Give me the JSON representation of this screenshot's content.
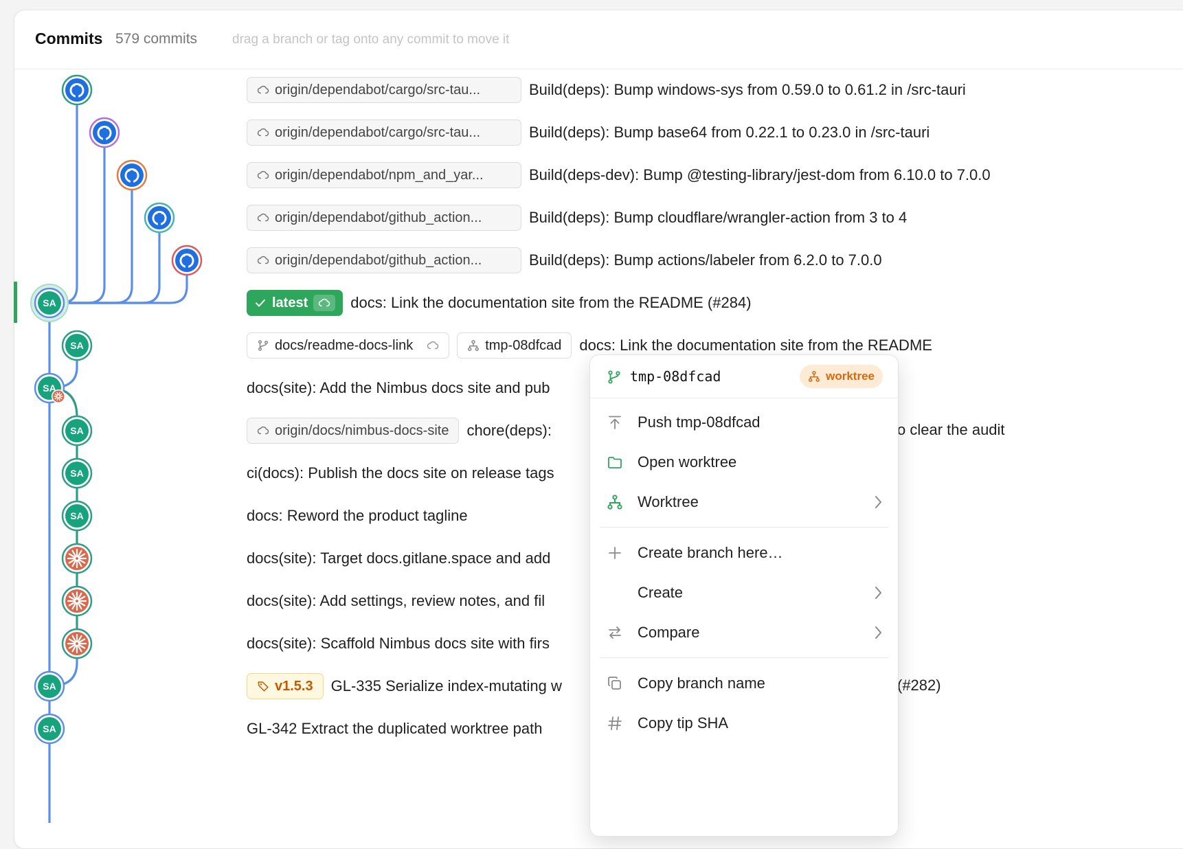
{
  "header": {
    "title": "Commits",
    "count": "579 commits",
    "hint": "drag a branch or tag onto any commit to move it"
  },
  "colors": {
    "graph_blue": "#5b8fe6",
    "graph_green": "#2e9c86",
    "node_green": "#17a37e",
    "github_blue": "#1f6fe0",
    "latest_green": "#2ea65b",
    "worktree_orange": "#d5690f",
    "tag_orange": "#c25a00"
  },
  "graph": {
    "nodes": [
      {
        "icon": "github-avatar-icon",
        "ring": "#2e9c86"
      },
      {
        "icon": "github-avatar-icon",
        "ring": "#b66fd8"
      },
      {
        "icon": "github-avatar-icon",
        "ring": "#e07d3c"
      },
      {
        "icon": "github-avatar-icon",
        "ring": "#43b3b3"
      },
      {
        "icon": "github-avatar-icon",
        "ring": "#dd5a5a"
      },
      {
        "label": "SA",
        "icon": "avatar",
        "selected": true
      },
      {
        "label": "SA",
        "icon": "avatar"
      },
      {
        "label": "SA",
        "icon": "avatar",
        "merge": true
      },
      {
        "label": "SA",
        "icon": "avatar"
      },
      {
        "label": "SA",
        "icon": "avatar"
      },
      {
        "label": "SA",
        "icon": "avatar"
      },
      {
        "icon": "claude-avatar-icon"
      },
      {
        "icon": "claude-avatar-icon"
      },
      {
        "icon": "claude-avatar-icon"
      },
      {
        "label": "SA",
        "icon": "avatar"
      },
      {
        "label": "SA",
        "icon": "avatar"
      }
    ]
  },
  "commits": [
    {
      "refs": [
        {
          "type": "remote",
          "label": "origin/dependabot/cargo/src-tau..."
        }
      ],
      "message": "Build(deps): Bump windows-sys from 0.59.0 to 0.61.2 in /src-tauri"
    },
    {
      "refs": [
        {
          "type": "remote",
          "label": "origin/dependabot/cargo/src-tau..."
        }
      ],
      "message": "Build(deps): Bump base64 from 0.22.1 to 0.23.0 in /src-tauri"
    },
    {
      "refs": [
        {
          "type": "remote",
          "label": "origin/dependabot/npm_and_yar..."
        }
      ],
      "message": "Build(deps-dev): Bump @testing-library/jest-dom from 6.10.0 to 7.0.0"
    },
    {
      "refs": [
        {
          "type": "remote",
          "label": "origin/dependabot/github_action..."
        }
      ],
      "message": "Build(deps): Bump cloudflare/wrangler-action from 3 to 4"
    },
    {
      "refs": [
        {
          "type": "remote",
          "label": "origin/dependabot/github_action..."
        }
      ],
      "message": "Build(deps): Bump actions/labeler from 6.2.0 to 7.0.0"
    },
    {
      "refs": [
        {
          "type": "latest",
          "label": "latest"
        }
      ],
      "message": "docs: Link the documentation site from the README (#284)"
    },
    {
      "refs": [
        {
          "type": "branch",
          "label": "docs/readme-docs-link"
        },
        {
          "type": "worktree",
          "label": "tmp-08dfcad"
        }
      ],
      "message": "docs: Link the documentation site from the README"
    },
    {
      "refs": [],
      "message": "docs(site): Add the Nimbus docs site and pub"
    },
    {
      "refs": [
        {
          "type": "remote-short",
          "label": "origin/docs/nimbus-docs-site"
        }
      ],
      "message": "chore(deps):",
      "message_tail": "o clear the audit"
    },
    {
      "refs": [],
      "message": "ci(docs): Publish the docs site on release tags"
    },
    {
      "refs": [],
      "message": "docs: Reword the product tagline"
    },
    {
      "refs": [],
      "message": "docs(site): Target docs.gitlane.space and add"
    },
    {
      "refs": [],
      "message": "docs(site): Add settings, review notes, and fil"
    },
    {
      "refs": [],
      "message": "docs(site): Scaffold Nimbus docs site with firs"
    },
    {
      "refs": [
        {
          "type": "tag",
          "label": "v1.5.3"
        }
      ],
      "message": "GL-335 Serialize index-mutating w",
      "message_tail": "(#282)"
    },
    {
      "refs": [],
      "message": "GL-342 Extract the duplicated worktree path"
    }
  ],
  "context_menu": {
    "branch_icon": "branch-icon",
    "branch": "tmp-08dfcad",
    "badge": "worktree",
    "groups": [
      [
        {
          "icon": "push-icon",
          "label": "Push tmp-08dfcad",
          "submenu": false
        },
        {
          "icon": "folder-icon",
          "label": "Open worktree",
          "submenu": false
        },
        {
          "icon": "worktree-icon",
          "label": "Worktree",
          "submenu": true
        }
      ],
      [
        {
          "icon": "plus-icon",
          "label": "Create branch here…",
          "submenu": false
        },
        {
          "icon": "",
          "label": "Create",
          "submenu": true
        },
        {
          "icon": "compare-icon",
          "label": "Compare",
          "submenu": true
        }
      ],
      [
        {
          "icon": "copy-icon",
          "label": "Copy branch name",
          "submenu": false
        },
        {
          "icon": "hash-icon",
          "label": "Copy tip SHA",
          "submenu": false
        }
      ]
    ]
  }
}
